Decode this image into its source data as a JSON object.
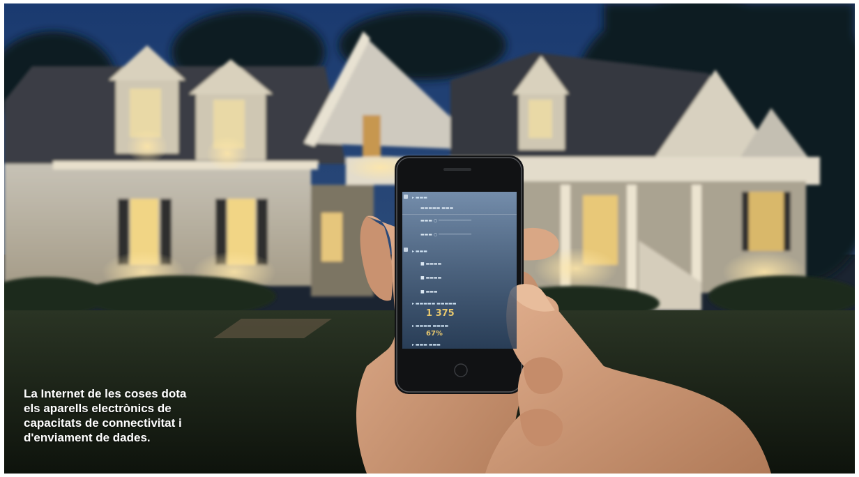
{
  "caption": {
    "lines": [
      "La Internet de les coses dota",
      "els aparells electrònics de",
      "capacitats de connectivitat i",
      "d'enviament de dades."
    ]
  },
  "phone_screen": {
    "reading_1": "1 375",
    "reading_2": "67%"
  },
  "colors": {
    "sky": "#1c3a6b",
    "lawn": "#1b2516",
    "house_wall": "#cfc8b8",
    "warm_light": "#f5d58c",
    "roof": "#3a3d44",
    "screen_accent": "#e7c76e",
    "skin": "#d6a17e"
  }
}
